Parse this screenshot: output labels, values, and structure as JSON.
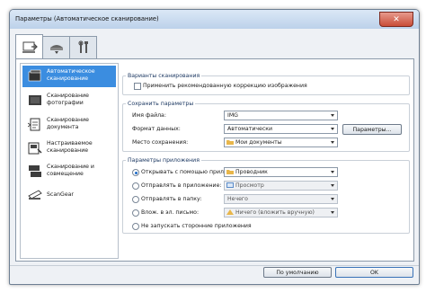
{
  "window": {
    "title": "Параметры (Автоматическое сканирование)",
    "close_glyph": "✕"
  },
  "tabs": [
    {
      "icon": "scan-to-pc-icon"
    },
    {
      "icon": "scanner-icon"
    },
    {
      "icon": "tools-icon"
    }
  ],
  "sidebar": {
    "items": [
      {
        "label": "Автоматическое сканирование",
        "icon": "auto-scan-icon"
      },
      {
        "label": "Сканирование фотографии",
        "icon": "photo-scan-icon"
      },
      {
        "label": "Сканирование документа",
        "icon": "document-scan-icon"
      },
      {
        "label": "Настраиваемое сканирование",
        "icon": "custom-scan-icon"
      },
      {
        "label": "Сканирование и совмещение",
        "icon": "stitch-scan-icon"
      },
      {
        "label": "ScanGear",
        "icon": "scangear-icon"
      }
    ]
  },
  "scan_options": {
    "title": "Варианты сканирования",
    "apply_correction": "Применить рекомендованную коррекцию изображения"
  },
  "save_settings": {
    "title": "Сохранить параметры",
    "file_name_label": "Имя файла:",
    "file_name_value": "IMG",
    "data_format_label": "Формат данных:",
    "data_format_value": "Автоматически",
    "params_button": "Параметры...",
    "save_location_label": "Место сохранения:",
    "save_location_value": "Мои документы"
  },
  "app_settings": {
    "title": "Параметры приложения",
    "options": [
      {
        "label": "Открывать с помощью приложения:",
        "value": "Проводник"
      },
      {
        "label": "Отправлять в приложение:",
        "value": "Просмотр"
      },
      {
        "label": "Отправлять в папку:",
        "value": "Нечего"
      },
      {
        "label": "Влож. в эл. письмо:",
        "value": "Ничего (вложить вручную)"
      },
      {
        "label": "Не запускать сторонние приложения",
        "value": ""
      }
    ]
  },
  "footer": {
    "defaults_button": "По умолчанию",
    "ok_button": "OK"
  },
  "colors": {
    "selection": "#3b8de0",
    "title_bar": "#c9dbf0",
    "folder": "#e8b64a"
  }
}
